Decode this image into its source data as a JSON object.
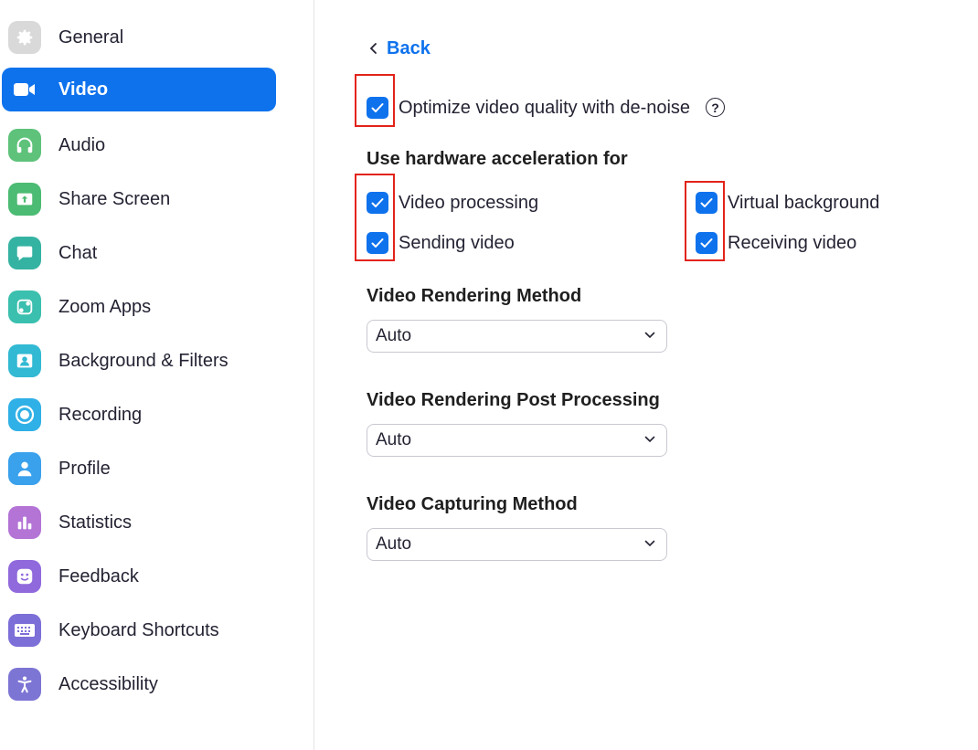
{
  "sidebar": {
    "items": [
      {
        "label": "General",
        "icon": "gear-icon",
        "color": "#d9d9d9",
        "active": false
      },
      {
        "label": "Video",
        "icon": "video-camera-icon",
        "color": "#0e72ed",
        "active": true
      },
      {
        "label": "Audio",
        "icon": "headphones-icon",
        "color": "#5ec27b",
        "active": false
      },
      {
        "label": "Share Screen",
        "icon": "share-screen-icon",
        "color": "#4cbb73",
        "active": false
      },
      {
        "label": "Chat",
        "icon": "chat-bubble-icon",
        "color": "#35b3a2",
        "active": false
      },
      {
        "label": "Zoom Apps",
        "icon": "apps-icon",
        "color": "#3bbfae",
        "active": false
      },
      {
        "label": "Background & Filters",
        "icon": "portrait-icon",
        "color": "#32b9d3",
        "active": false
      },
      {
        "label": "Recording",
        "icon": "record-icon",
        "color": "#2fb0e6",
        "active": false
      },
      {
        "label": "Profile",
        "icon": "person-icon",
        "color": "#3aa1ec",
        "active": false
      },
      {
        "label": "Statistics",
        "icon": "bar-chart-icon",
        "color": "#b374d6",
        "active": false
      },
      {
        "label": "Feedback",
        "icon": "smiley-icon",
        "color": "#9069dc",
        "active": false
      },
      {
        "label": "Keyboard Shortcuts",
        "icon": "keyboard-icon",
        "color": "#7d6fd8",
        "active": false
      },
      {
        "label": "Accessibility",
        "icon": "accessibility-icon",
        "color": "#7d75d4",
        "active": false
      }
    ]
  },
  "main": {
    "back_label": "Back",
    "denoise": {
      "label": "Optimize video quality with de-noise",
      "checked": true
    },
    "hw_accel": {
      "title": "Use hardware acceleration for",
      "video_processing": {
        "label": "Video processing",
        "checked": true
      },
      "sending_video": {
        "label": "Sending video",
        "checked": true
      },
      "virtual_background": {
        "label": "Virtual background",
        "checked": true
      },
      "receiving_video": {
        "label": "Receiving video",
        "checked": true
      }
    },
    "rendering_method": {
      "title": "Video Rendering Method",
      "value": "Auto"
    },
    "post_processing": {
      "title": "Video Rendering Post Processing",
      "value": "Auto"
    },
    "capturing_method": {
      "title": "Video Capturing Method",
      "value": "Auto"
    }
  }
}
